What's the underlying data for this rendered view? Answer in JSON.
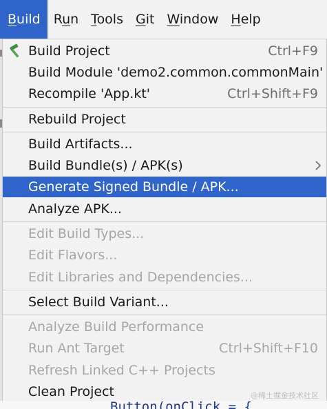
{
  "menubar": {
    "items": [
      {
        "label": "Build",
        "mnemonic_index": 0
      },
      {
        "label": "Run",
        "mnemonic_index": 1
      },
      {
        "label": "Tools",
        "mnemonic_index": 0
      },
      {
        "label": "Git",
        "mnemonic_index": 0
      },
      {
        "label": "Window",
        "mnemonic_index": 0
      },
      {
        "label": "Help",
        "mnemonic_index": 0
      }
    ]
  },
  "build_menu": {
    "items": [
      {
        "label": "Build Project",
        "shortcut": "Ctrl+F9",
        "icon": "hammer-icon",
        "enabled": true
      },
      {
        "label": "Build Module 'demo2.common.commonMain'",
        "shortcut": "",
        "enabled": true
      },
      {
        "label": "Recompile 'App.kt'",
        "shortcut": "Ctrl+Shift+F9",
        "enabled": true
      },
      {
        "label": "Rebuild Project",
        "shortcut": "",
        "enabled": true
      },
      {
        "label": "Build Artifacts...",
        "shortcut": "",
        "enabled": true
      },
      {
        "label": "Build Bundle(s) / APK(s)",
        "shortcut": "",
        "submenu": true,
        "enabled": true
      },
      {
        "label": "Generate Signed Bundle / APK...",
        "shortcut": "",
        "enabled": true,
        "selected": true
      },
      {
        "label": "Analyze APK...",
        "shortcut": "",
        "enabled": true
      },
      {
        "label": "Edit Build Types...",
        "shortcut": "",
        "enabled": false
      },
      {
        "label": "Edit Flavors...",
        "shortcut": "",
        "enabled": false
      },
      {
        "label": "Edit Libraries and Dependencies...",
        "shortcut": "",
        "enabled": false
      },
      {
        "label": "Select Build Variant...",
        "shortcut": "",
        "enabled": true
      },
      {
        "label": "Analyze Build Performance",
        "shortcut": "",
        "enabled": false
      },
      {
        "label": "Run Ant Target",
        "shortcut": "Ctrl+Shift+F10",
        "enabled": false
      },
      {
        "label": "Refresh Linked C++ Projects",
        "shortcut": "",
        "enabled": false
      },
      {
        "label": "Clean Project",
        "shortcut": "",
        "enabled": true
      }
    ]
  },
  "editor": {
    "code_fragment": "Button(onClick = {"
  },
  "watermark": "@稀土掘金技术社区",
  "colors": {
    "accent": "#2f65ca",
    "menu_bg": "#f2f2f2",
    "disabled_text": "#a6a6a6",
    "shortcut_text": "#6e6e6e"
  }
}
